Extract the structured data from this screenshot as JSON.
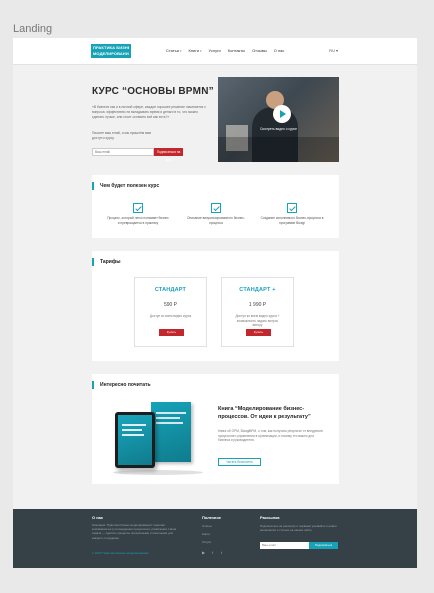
{
  "frame_label": "Landing",
  "header": {
    "logo_lines": [
      "ПРАКТИКА БИЗНЕС",
      "МОДЕЛИРОВАНИЯ"
    ],
    "nav": [
      {
        "label": "Статьи",
        "has_caret": true
      },
      {
        "label": "Книги",
        "has_caret": true
      },
      {
        "label": "Услуги",
        "has_caret": false
      },
      {
        "label": "Контакты",
        "has_caret": false
      },
      {
        "label": "Отзывы",
        "has_caret": false
      },
      {
        "label": "О нас",
        "has_caret": false
      }
    ],
    "lang": "RU"
  },
  "hero": {
    "title": "КУРС “ОСНОВЫ BPMN”",
    "description": "«В бизнесе как и в личной сфере, каждое хорошее решение начинается с вопроса: эффективно ли вкладывать время и деньги в то, что можно сделать лучше, или стоит оставить всё как есть?»",
    "note": "Пишите ваш email, и мы пришлём вам доступ к курсу.",
    "email_placeholder": "Ваш email",
    "subscribe_label": "Подписаться на курс",
    "video_caption": "Смотреть видео о курсе"
  },
  "benefits": {
    "title": "Чем будет полезен курс",
    "items": [
      "Процесс, который легко понимает бизнес и превращается в практику",
      "Описание визуализированного бизнес-процесса",
      "Создание исполнимого бизнес-процесса в программе Bizagi"
    ]
  },
  "tariffs": {
    "title": "Тарифы",
    "plans": [
      {
        "name": "СТАНДАРТ",
        "price": "590 Р",
        "desc": "Доступ ко всем видео курса",
        "button": "Купить"
      },
      {
        "name": "СТАНДАРТ +",
        "price": "1 990 Р",
        "desc": "Доступ ко всем видео курса + возможность задать вопрос автору",
        "button": "Купить"
      }
    ]
  },
  "reading": {
    "title": "Интересно почитать",
    "book_title": "Книга “Моделирование бизнес-процессов. От идеи к результату”",
    "book_desc": "Книга об ОРМ, BizagiBPM, о том, как получать результат от внедрения процессного управления в организации, и почему это важно для бизнеса и руководителя.",
    "book_button": "Читать бесплатно"
  },
  "footer": {
    "about_title": "О нас",
    "about_text": "Компания “Практика бизнес моделирования” помогает компаниям на пути внедрения процессного управления. Наша задача — сделать процессы прозрачными и понятными для каждого сотрудника.",
    "about_link": "© 2017 Практика бизнес-моделирования",
    "useful_title": "Полезное",
    "useful_links": [
      "Статьи",
      "Книги",
      "Услуги"
    ],
    "social_icons": [
      "youtube-icon",
      "facebook-icon",
      "twitter-icon"
    ],
    "social_glyphs": [
      "▶",
      "f",
      "t"
    ],
    "newsletter_title": "Рассылка",
    "newsletter_text": "Подпишитесь на рассылку и первыми узнавайте о новых материалах и статьях на нашем сайте.",
    "email_placeholder": "Ваш email",
    "subscribe_label": "Подписаться"
  },
  "colors": {
    "accent": "#17a2b8",
    "cta": "#c1272d",
    "footer_bg": "#354047"
  }
}
